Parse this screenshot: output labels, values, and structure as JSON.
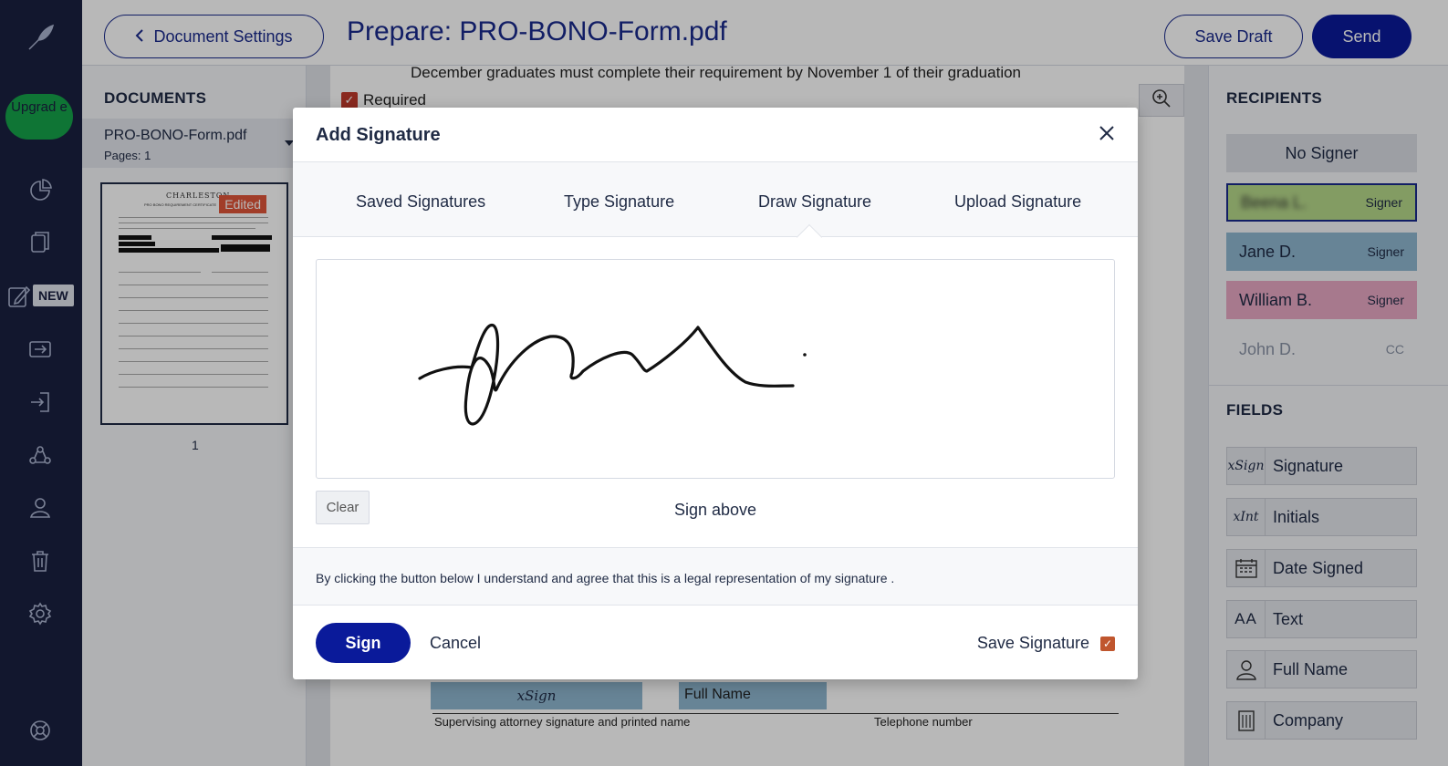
{
  "rail": {
    "upgrade_label": "Upgrad e",
    "new_badge": "NEW"
  },
  "header": {
    "back_button": "Document Settings",
    "title": "Prepare: PRO-BONO-Form.pdf",
    "save_draft": "Save Draft",
    "send": "Send"
  },
  "documents": {
    "heading": "DOCUMENTS",
    "items": [
      {
        "name": "PRO-BONO-Form.pdf",
        "pages": "Pages: 1"
      }
    ],
    "thumb_badge": "Edited",
    "thumb_title": "CHARLESTON",
    "thumb_subtitle": "PRO BONO REQUIREMENT CERTIFICATE",
    "page_number": "1"
  },
  "document": {
    "visible_text": "December graduates must complete their requirement by November 1 of their graduation",
    "required_label": "Required",
    "sign_field": "xSign",
    "fullname_field": "Full Name",
    "caption_left": "Supervising attorney signature and printed name",
    "caption_right": "Telephone number"
  },
  "recipients": {
    "heading": "RECIPIENTS",
    "items": [
      {
        "name": "No Signer",
        "role": ""
      },
      {
        "name": "Beena L.",
        "role": "Signer",
        "color": "#b6d88a"
      },
      {
        "name": "Jane D.",
        "role": "Signer",
        "color": "#8fb7d0"
      },
      {
        "name": "William B.",
        "role": "Signer",
        "color": "#e8a8c4"
      },
      {
        "name": "John D.",
        "role": "CC"
      }
    ]
  },
  "fields": {
    "heading": "FIELDS",
    "items": [
      {
        "label": "Signature",
        "icon": "signature-icon",
        "glyph": "xSign"
      },
      {
        "label": "Initials",
        "icon": "initials-icon",
        "glyph": "xInt"
      },
      {
        "label": "Date Signed",
        "icon": "calendar-icon",
        "glyph": ""
      },
      {
        "label": "Text",
        "icon": "text-icon",
        "glyph": "AA"
      },
      {
        "label": "Full Name",
        "icon": "person-icon",
        "glyph": ""
      },
      {
        "label": "Company",
        "icon": "building-icon",
        "glyph": ""
      }
    ]
  },
  "modal": {
    "title": "Add Signature",
    "tabs": [
      "Saved Signatures",
      "Type Signature",
      "Draw Signature",
      "Upload Signature"
    ],
    "active_tab": "Draw Signature",
    "clear": "Clear",
    "hint": "Sign above",
    "legal": "By clicking the button below I understand and agree that this is a legal representation of my signature .",
    "sign": "Sign",
    "cancel": "Cancel",
    "save_signature": "Save Signature",
    "save_signature_checked": true
  },
  "colors": {
    "rail": "#1a2040",
    "primary": "#0a1a9a",
    "upgrade": "#16a34a",
    "edited_badge": "#e0553a"
  }
}
